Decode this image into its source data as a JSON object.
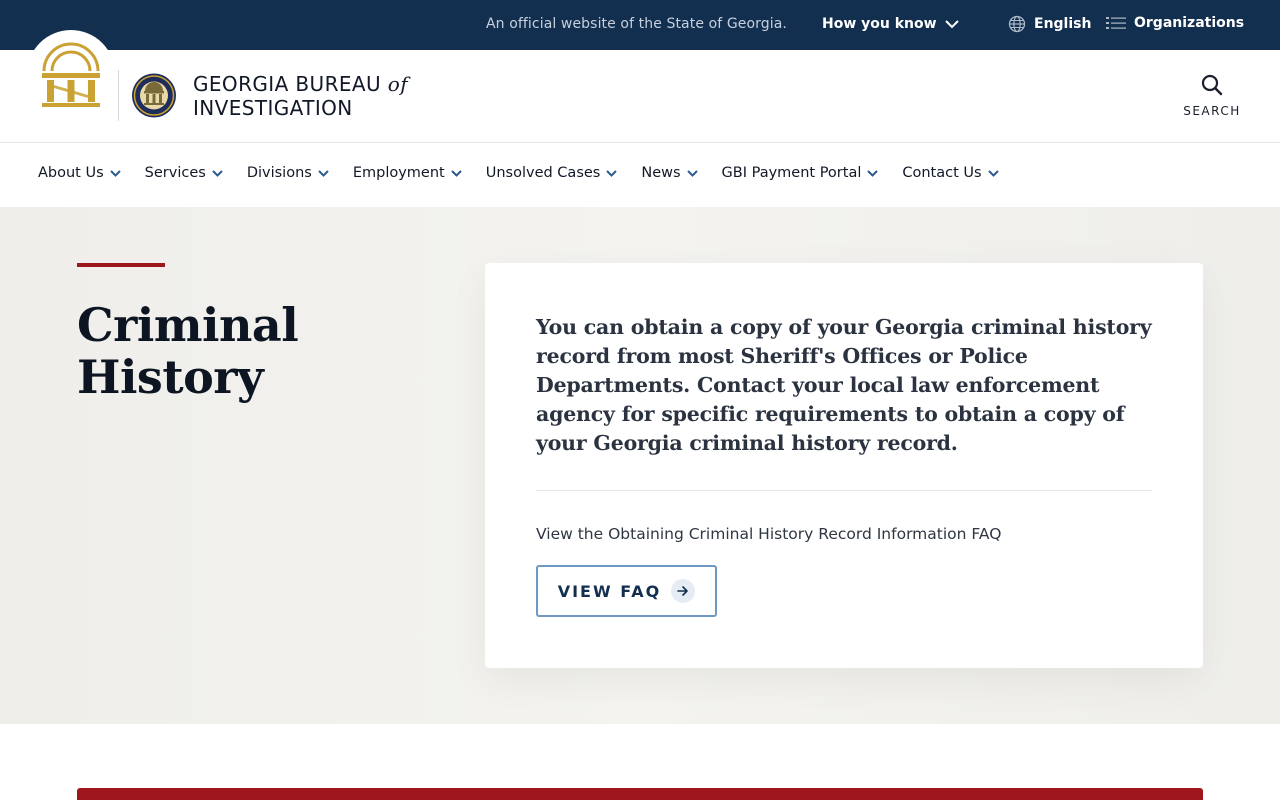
{
  "topbar": {
    "official_text": "An official website of the State of Georgia.",
    "how_you_know": "How you know",
    "language": "English",
    "organizations": "Organizations"
  },
  "header": {
    "brand_line1": "GEORGIA BUREAU",
    "brand_of": "of",
    "brand_line2": "INVESTIGATION",
    "search_label": "SEARCH"
  },
  "nav": {
    "items": [
      {
        "label": "About Us"
      },
      {
        "label": "Services"
      },
      {
        "label": "Divisions"
      },
      {
        "label": "Employment"
      },
      {
        "label": "Unsolved Cases"
      },
      {
        "label": "News"
      },
      {
        "label": "GBI Payment Portal"
      },
      {
        "label": "Contact Us"
      }
    ]
  },
  "hero": {
    "title_line1": "Criminal",
    "title_line2": "History",
    "lead": "You can obtain a copy of your Georgia criminal history record from most Sheriff's Offices or Police Departments. Contact your local law enforcement agency for specific requirements to obtain a copy of your Georgia criminal history record.",
    "faq_text": "View the Obtaining Criminal History Record Information FAQ",
    "faq_button": "VIEW FAQ"
  },
  "colors": {
    "topbar_bg": "#132f4f",
    "accent_red": "#a0161e",
    "button_border": "#6d99c2",
    "seal_gold": "#c9a233"
  }
}
